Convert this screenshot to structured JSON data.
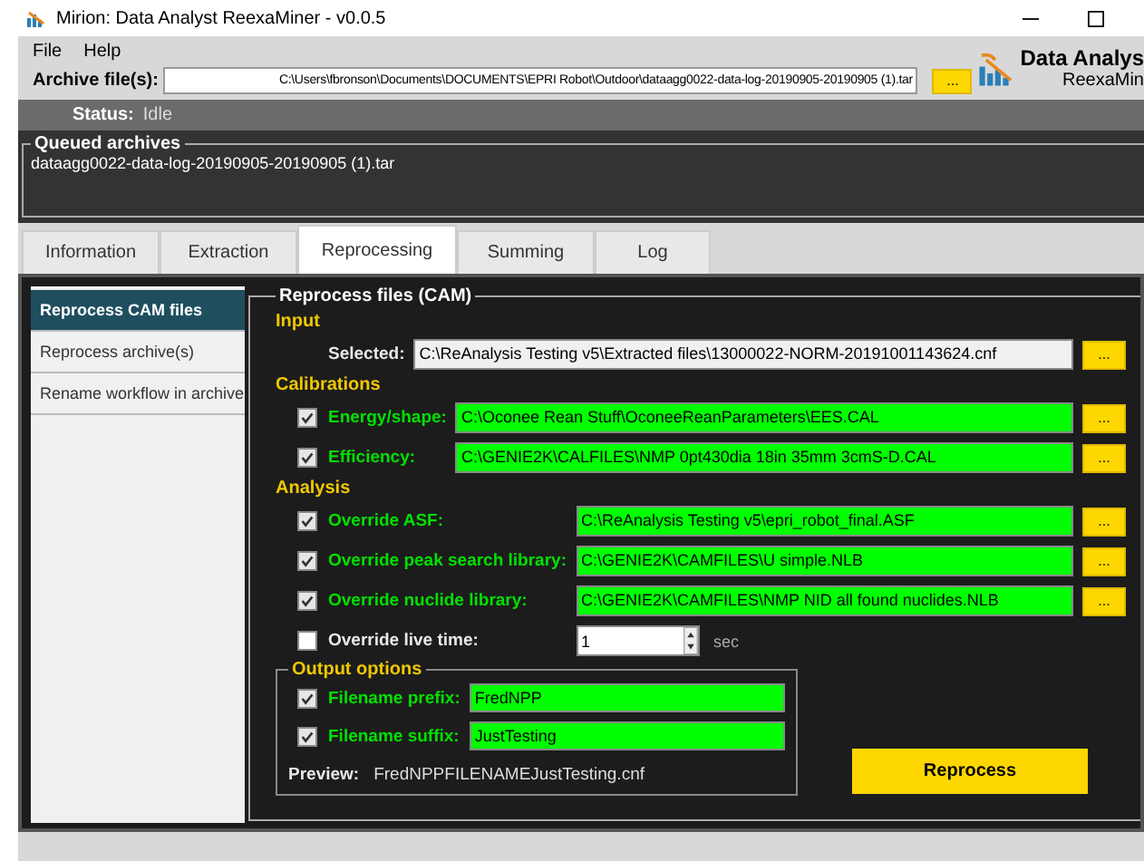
{
  "window": {
    "title": "Mirion: Data Analyst ReexaMiner - v0.0.5"
  },
  "menu": [
    "File",
    "Help"
  ],
  "archive": {
    "label": "Archive file(s):",
    "value": "C:\\Users\\fbronson\\Documents\\DOCUMENTS\\EPRI Robot\\Outdoor\\dataagg0022-data-log-20190905-20190905 (1).tar",
    "button": "..."
  },
  "logo": {
    "title": "Data Analys",
    "subtitle": "ReexaMin"
  },
  "status": {
    "label": "Status:",
    "value": "Idle"
  },
  "queued": {
    "title": "Queued archives",
    "items": [
      "dataagg0022-data-log-20190905-20190905 (1).tar"
    ]
  },
  "tabs": [
    {
      "label": "Information",
      "selected": false
    },
    {
      "label": "Extraction",
      "selected": false
    },
    {
      "label": "Reprocessing",
      "selected": true
    },
    {
      "label": "Summing",
      "selected": false
    },
    {
      "label": "Log",
      "selected": false
    }
  ],
  "sidebar": {
    "items": [
      {
        "label": "Reprocess CAM files",
        "selected": true
      },
      {
        "label": "Reprocess archive(s)",
        "selected": false
      },
      {
        "label": "Rename workflow in archive",
        "selected": false
      }
    ]
  },
  "panel": {
    "title": "Reprocess files (CAM)",
    "sections": [
      {
        "title": "Input",
        "rows": [
          {
            "kind": "file",
            "label": "Selected:",
            "value": "C:\\ReAnalysis Testing v5\\Extracted files\\13000022-NORM-20191001143624.cnf",
            "valid": false,
            "button": "..."
          }
        ]
      },
      {
        "title": "Calibrations",
        "rows": [
          {
            "kind": "file",
            "checked": true,
            "label": "Energy/shape:",
            "value": "C:\\Oconee Rean Stuff\\OconeeReanParameters\\EES.CAL",
            "valid": true,
            "button": "..."
          },
          {
            "kind": "file",
            "checked": true,
            "label": "Efficiency:",
            "value": "C:\\GENIE2K\\CALFILES\\NMP 0pt430dia 18in 35mm 3cmS-D.CAL",
            "valid": true,
            "button": "..."
          }
        ]
      },
      {
        "title": "Analysis",
        "rows": [
          {
            "kind": "file",
            "checked": true,
            "label": "Override ASF:",
            "value": "C:\\ReAnalysis Testing v5\\epri_robot_final.ASF",
            "valid": true,
            "button": "..."
          },
          {
            "kind": "file",
            "checked": true,
            "label": "Override peak search library:",
            "value": "C:\\GENIE2K\\CAMFILES\\U simple.NLB",
            "valid": true,
            "button": "..."
          },
          {
            "kind": "file",
            "checked": true,
            "label": "Override nuclide library:",
            "value": "C:\\GENIE2K\\CAMFILES\\NMP NID all found nuclides.NLB",
            "valid": true,
            "button": "..."
          },
          {
            "kind": "number",
            "checked": false,
            "label": "Override live time:",
            "value": "1",
            "unit": "sec"
          }
        ]
      }
    ]
  },
  "output": {
    "title": "Output options",
    "rows": [
      {
        "checked": true,
        "label": "Filename prefix:",
        "value": "FredNPP"
      },
      {
        "checked": true,
        "label": "Filename suffix:",
        "value": "JustTesting"
      }
    ],
    "preview_label": "Preview:",
    "preview": "FredNPPFILENAMEJustTesting.cnf"
  },
  "action": "Reprocess"
}
